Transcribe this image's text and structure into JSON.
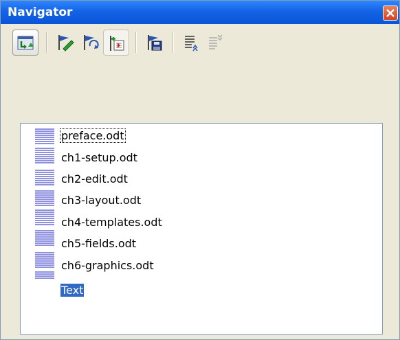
{
  "window": {
    "title": "Navigator"
  },
  "toolbar": {
    "buttons": [
      {
        "name": "toggle-button",
        "icon": "toggle-icon"
      },
      {
        "name": "edit-button",
        "icon": "edit-icon"
      },
      {
        "name": "update-button",
        "icon": "update-icon"
      },
      {
        "name": "insert-button",
        "icon": "insert-icon"
      },
      {
        "name": "save-as-button",
        "icon": "save-as-icon"
      },
      {
        "name": "move-up-button",
        "icon": "move-up-icon"
      },
      {
        "name": "move-down-button",
        "icon": "move-down-icon"
      }
    ]
  },
  "documents": [
    {
      "label": "preface.odt"
    },
    {
      "label": "ch1-setup.odt"
    },
    {
      "label": "ch2-edit.odt"
    },
    {
      "label": "ch3-layout.odt"
    },
    {
      "label": "ch4-templates.odt"
    },
    {
      "label": "ch5-fields.odt"
    },
    {
      "label": "ch6-graphics.odt"
    },
    {
      "label": "Text"
    }
  ],
  "colors": {
    "title_bar": "#0a55d6",
    "selection": "#316ac5",
    "background": "#ece9d8",
    "doc_lines": "#6b6bd6"
  }
}
